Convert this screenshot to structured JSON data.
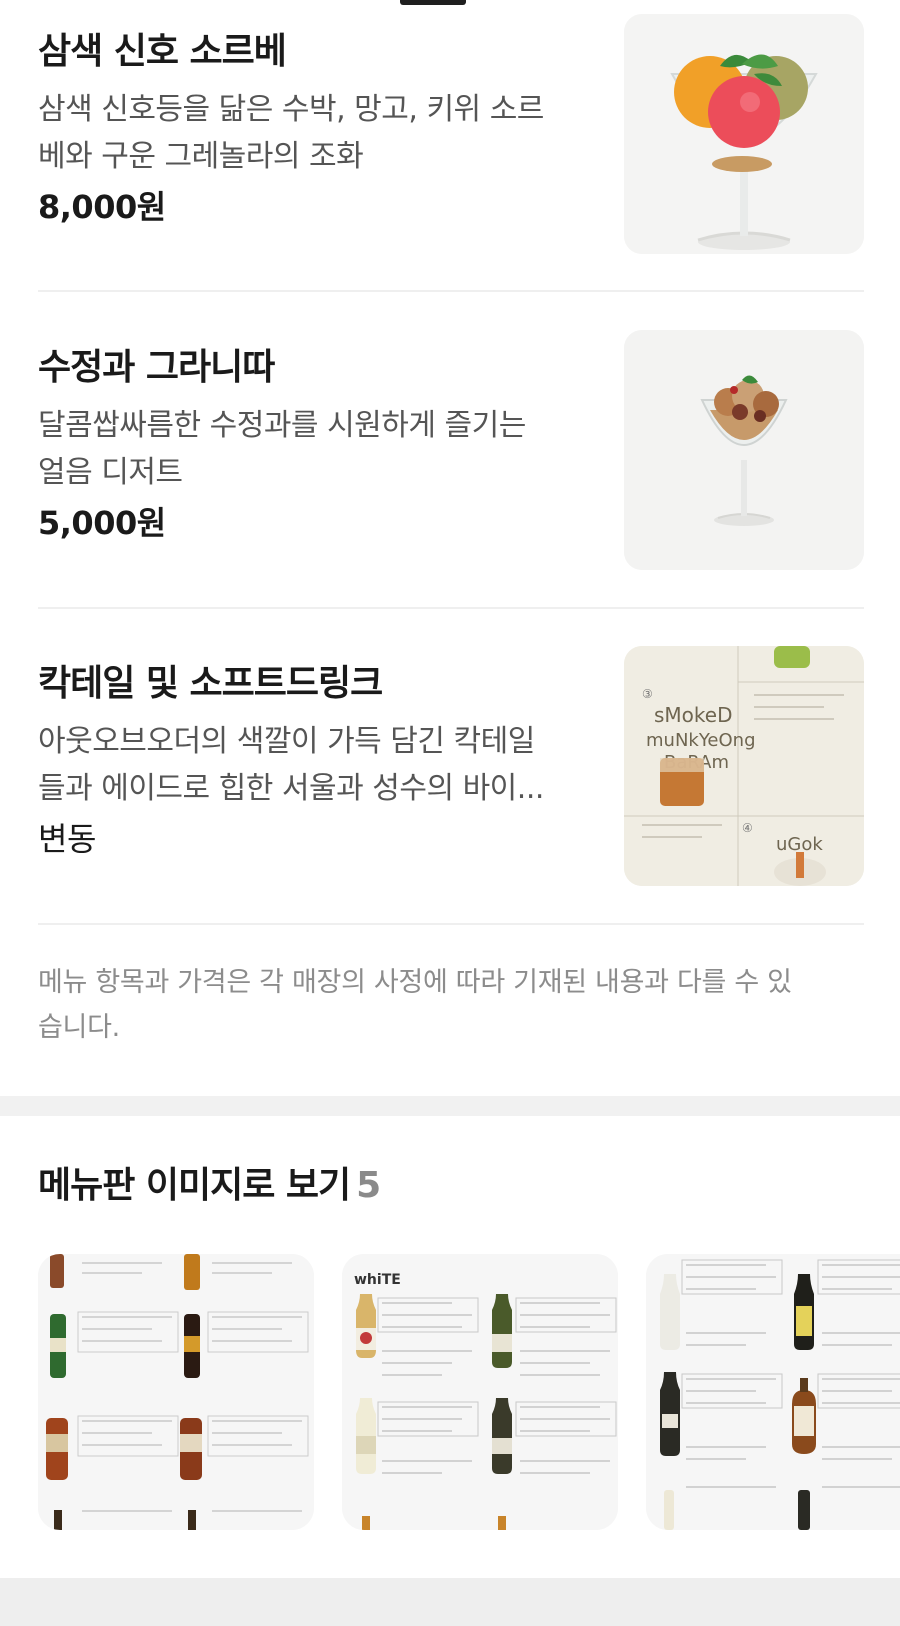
{
  "menu_items": [
    {
      "name": "삼색 신호 소르베",
      "desc_line1": "삼색 신호등을 닮은 수박, 망고, 키위 소르",
      "desc_line2": "베와 구운 그레놀라의 조화",
      "price": "8,000원",
      "image_icon": "sorbet-glass-image"
    },
    {
      "name": "수정과 그라니따",
      "desc_line1": "달콤쌉싸름한 수정과를 시원하게 즐기는",
      "desc_line2": "얼음 디저트",
      "price": "5,000원",
      "image_icon": "granita-glass-image"
    },
    {
      "name": "칵테일 및 소프트드링크",
      "desc_line1": "아웃오브오더의 색깔이 가득 담긴 칵테일",
      "desc_line2": "들과 에이드로 힙한 서울과 성수의 바이...",
      "price": "변동",
      "image_icon": "cocktail-menu-image",
      "image_text": {
        "title_line1": "sMokeD",
        "title_line2": "muNkYeOng",
        "title_line3": "BaRAm",
        "num1": "③",
        "num2": "④",
        "subtitle": "uGok"
      }
    }
  ],
  "notice": {
    "line1": "메뉴 항목과 가격은 각 매장의 사정에 따라 기재된 내용과 다를 수 있",
    "line2": "습니다."
  },
  "menu_board": {
    "title": "메뉴판 이미지로 보기",
    "count": "5",
    "cards": [
      {
        "icon": "whisky-menu-image"
      },
      {
        "icon": "white-wine-menu-image",
        "label": "whiTE"
      },
      {
        "icon": "traditional-liquor-menu-image"
      }
    ]
  },
  "colors": {
    "primary_text": "#1a1a1a",
    "secondary_text": "#555555",
    "muted_text": "#8c8c8c",
    "divider": "#efefef",
    "thumb_bg": "#f4f4f3"
  }
}
